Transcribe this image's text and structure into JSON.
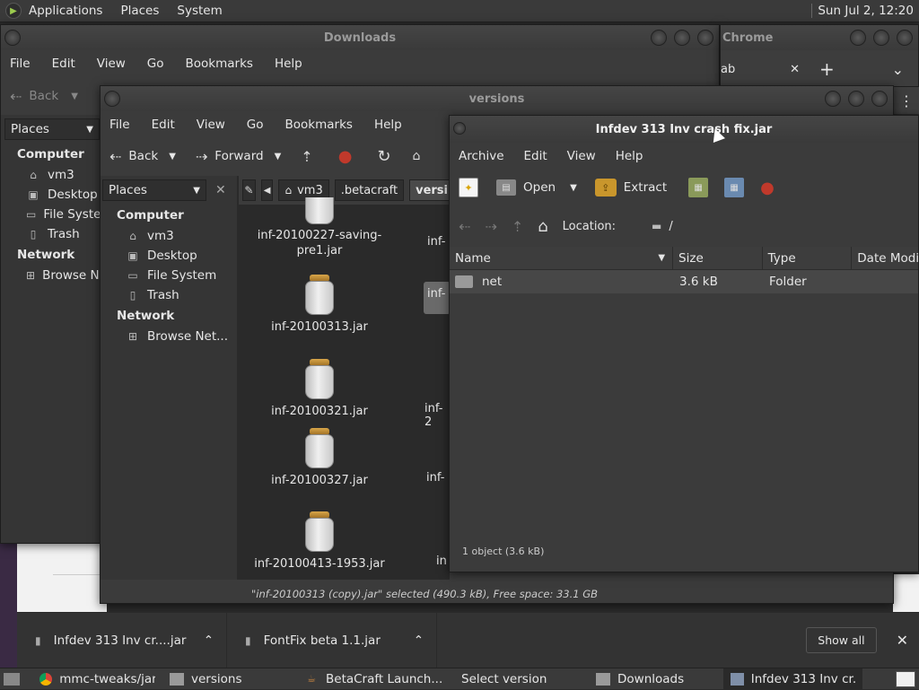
{
  "topbar": {
    "menus": [
      "Applications",
      "Places",
      "System"
    ],
    "clock": "Sun Jul  2, 12:20"
  },
  "downloads_window": {
    "title": "Downloads",
    "menus": [
      "File",
      "Edit",
      "View",
      "Go",
      "Bookmarks",
      "Help"
    ],
    "back_label": "Back",
    "places_label": "Places",
    "sections": [
      {
        "head": "Computer",
        "items": [
          {
            "label": "vm3",
            "icon": "home-icon"
          },
          {
            "label": "Desktop",
            "icon": "desktop-icon"
          },
          {
            "label": "File System",
            "icon": "drive-icon"
          },
          {
            "label": "Trash",
            "icon": "trash-icon"
          }
        ]
      },
      {
        "head": "Network",
        "items": [
          {
            "label": "Browse Network",
            "icon": "network-icon"
          }
        ]
      }
    ]
  },
  "chrome_window": {
    "title": "Chrome",
    "tab_fragment": "ab",
    "close_glyph": "✕",
    "new_tab_glyph": "+",
    "dropdown_glyph": "⌄",
    "more_glyph": "⋮"
  },
  "versions_window": {
    "title": "versions",
    "menus": [
      "File",
      "Edit",
      "View",
      "Go",
      "Bookmarks",
      "Help"
    ],
    "back_label": "Back",
    "forward_label": "Forward",
    "places_label": "Places",
    "path": [
      "vm3",
      ".betacraft",
      "versi"
    ],
    "sections": [
      {
        "head": "Computer",
        "items": [
          {
            "label": "vm3",
            "icon": "home-icon"
          },
          {
            "label": "Desktop",
            "icon": "desktop-icon"
          },
          {
            "label": "File System",
            "icon": "drive-icon"
          },
          {
            "label": "Trash",
            "icon": "trash-icon"
          }
        ]
      },
      {
        "head": "Network",
        "items": [
          {
            "label": "Browse Net...",
            "icon": "network-icon"
          }
        ]
      }
    ],
    "files": [
      {
        "label": "inf-20100227-saving-pre1.jar"
      },
      {
        "label": "inf-20100313.jar"
      },
      {
        "label": "inf-20100321.jar"
      },
      {
        "label": "inf-20100327.jar"
      },
      {
        "label": "inf-20100413-1953.jar"
      }
    ],
    "files_col2": [
      "inf-",
      "inf-",
      "inf-2",
      "inf-",
      "in"
    ],
    "status": "\"inf-20100313 (copy).jar\" selected (490.3 kB), Free space: 33.1 GB"
  },
  "archive_window": {
    "title": "Infdev 313 Inv crash fix.jar",
    "menus": [
      "Archive",
      "Edit",
      "View",
      "Help"
    ],
    "open_label": "Open",
    "extract_label": "Extract",
    "location_label": "Location:",
    "location_value": "/",
    "columns": [
      "Name",
      "Size",
      "Type",
      "Date Modif"
    ],
    "rows": [
      {
        "name": "net",
        "size": "3.6 kB",
        "type": "Folder"
      }
    ],
    "status": "1 object (3.6 kB)"
  },
  "download_bar": {
    "items": [
      {
        "label": "Infdev 313 Inv cr....jar"
      },
      {
        "label": "FontFix beta 1.1.jar"
      }
    ],
    "show_all": "Show all",
    "close_glyph": "✕",
    "chevron_glyph": "⌃"
  },
  "taskbar": {
    "items": [
      {
        "label": "mmc-tweaks/jar...",
        "icon": "chrome-icon"
      },
      {
        "label": "versions",
        "icon": "folder-icon"
      },
      {
        "label": "BetaCraft Launch...",
        "icon": "java-icon"
      },
      {
        "label": "Select version",
        "icon": "none"
      },
      {
        "label": "Downloads",
        "icon": "folder-icon"
      },
      {
        "label": "Infdev 313 Inv cr...",
        "icon": "archive-icon"
      }
    ]
  }
}
